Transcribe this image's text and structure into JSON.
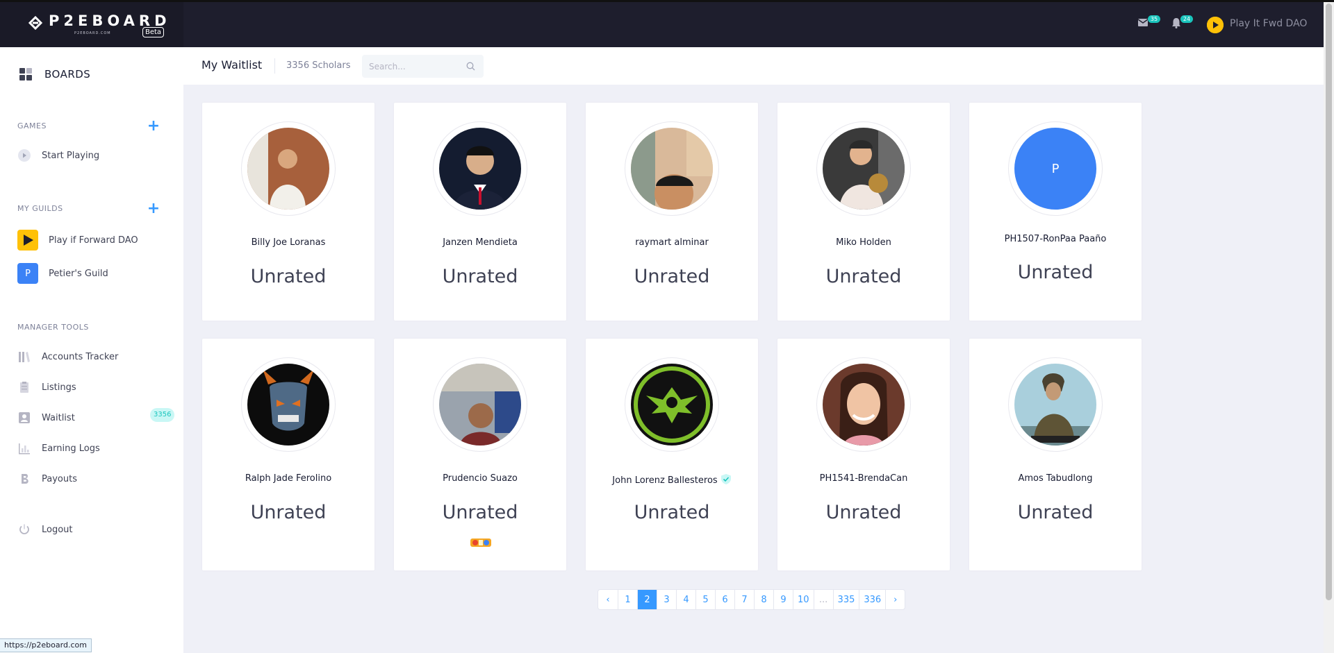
{
  "app": {
    "logo_text": "P2EBOARD",
    "logo_subtext": "P2EBOARD.COM",
    "beta_label": "Beta",
    "mail_count": "35",
    "notification_count": "24",
    "user_name": "Play It Fwd DAO"
  },
  "sidebar": {
    "boards_label": "BOARDS",
    "games_section": "GAMES",
    "start_playing": "Start Playing",
    "guilds_section": "MY GUILDS",
    "guilds": [
      {
        "name": "Play if Forward DAO",
        "color": "#ffc107"
      },
      {
        "name": "Petier's Guild",
        "initial": "P",
        "color": "#3b82f6"
      }
    ],
    "manager_section": "MANAGER TOOLS",
    "tools": {
      "accounts_tracker": "Accounts Tracker",
      "listings": "Listings",
      "waitlist": "Waitlist",
      "waitlist_count": "3356",
      "earning_logs": "Earning Logs",
      "payouts": "Payouts"
    },
    "logout": "Logout"
  },
  "subheader": {
    "title": "My Waitlist",
    "count": "3356 Scholars",
    "search_placeholder": "Search..."
  },
  "scholars": [
    {
      "name": "Billy Joe Loranas",
      "rating": "Unrated",
      "avatar_color": "#b0764e"
    },
    {
      "name": "Janzen Mendieta",
      "rating": "Unrated",
      "avatar_color": "#1f2a44"
    },
    {
      "name": "raymart alminar",
      "rating": "Unrated",
      "avatar_color": "#c9a27e"
    },
    {
      "name": "Miko Holden",
      "rating": "Unrated",
      "avatar_color": "#4c4c4c"
    },
    {
      "name": "PH1507-RonPaa Paaño",
      "rating": "Unrated",
      "avatar_initial": "P",
      "avatar_color": "#3b82f6"
    },
    {
      "name": "Ralph Jade Ferolino",
      "rating": "Unrated",
      "avatar_color": "#0d0d0d"
    },
    {
      "name": "Prudencio Suazo",
      "rating": "Unrated",
      "avatar_color": "#6e7b8f",
      "game_badge": "game-logo-icon"
    },
    {
      "name": "John Lorenz Ballesteros",
      "rating": "Unrated",
      "avatar_color": "#1a1a1a",
      "verified": true
    },
    {
      "name": "PH1541-BrendaCan",
      "rating": "Unrated",
      "avatar_color": "#7a4a3a"
    },
    {
      "name": "Amos Tabudlong",
      "rating": "Unrated",
      "avatar_color": "#8fb8c7"
    }
  ],
  "pagination": {
    "prev": "‹",
    "pages": [
      "1",
      "2",
      "3",
      "4",
      "5",
      "6",
      "7",
      "8",
      "9",
      "10",
      "...",
      "335",
      "336"
    ],
    "active": "2",
    "next": "›"
  },
  "status_url": "https://p2eboard.com"
}
